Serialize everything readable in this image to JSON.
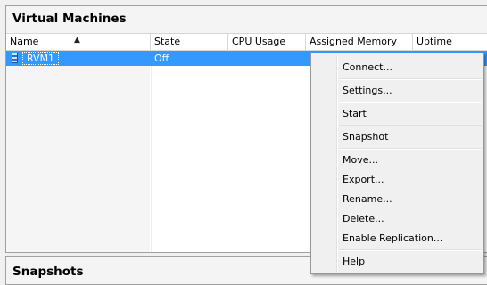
{
  "vm_panel": {
    "title": "Virtual Machines",
    "columns": [
      "Name",
      "State",
      "CPU Usage",
      "Assigned Memory",
      "Uptime"
    ],
    "sorted_column": "Name",
    "rows": [
      {
        "name": "RVM1",
        "state": "Off",
        "cpu": "",
        "memory": "",
        "uptime": ""
      }
    ]
  },
  "snapshots_panel": {
    "title": "Snapshots"
  },
  "context_menu": {
    "items": [
      {
        "label": "Connect..."
      },
      {
        "label": "Settings..."
      },
      {
        "label": "Start"
      },
      {
        "label": "Snapshot"
      },
      {
        "label": "Move..."
      },
      {
        "label": "Export..."
      },
      {
        "label": "Rename..."
      },
      {
        "label": "Delete..."
      },
      {
        "label": "Enable Replication..."
      },
      {
        "label": "Help"
      }
    ]
  },
  "colors": {
    "selection": "#3399ff",
    "panel_border": "#a0a0a0",
    "menu_background": "#f0f0f0"
  },
  "icons": {
    "vm": "virtual-machine-icon",
    "sort": "sort-ascending-arrow"
  }
}
